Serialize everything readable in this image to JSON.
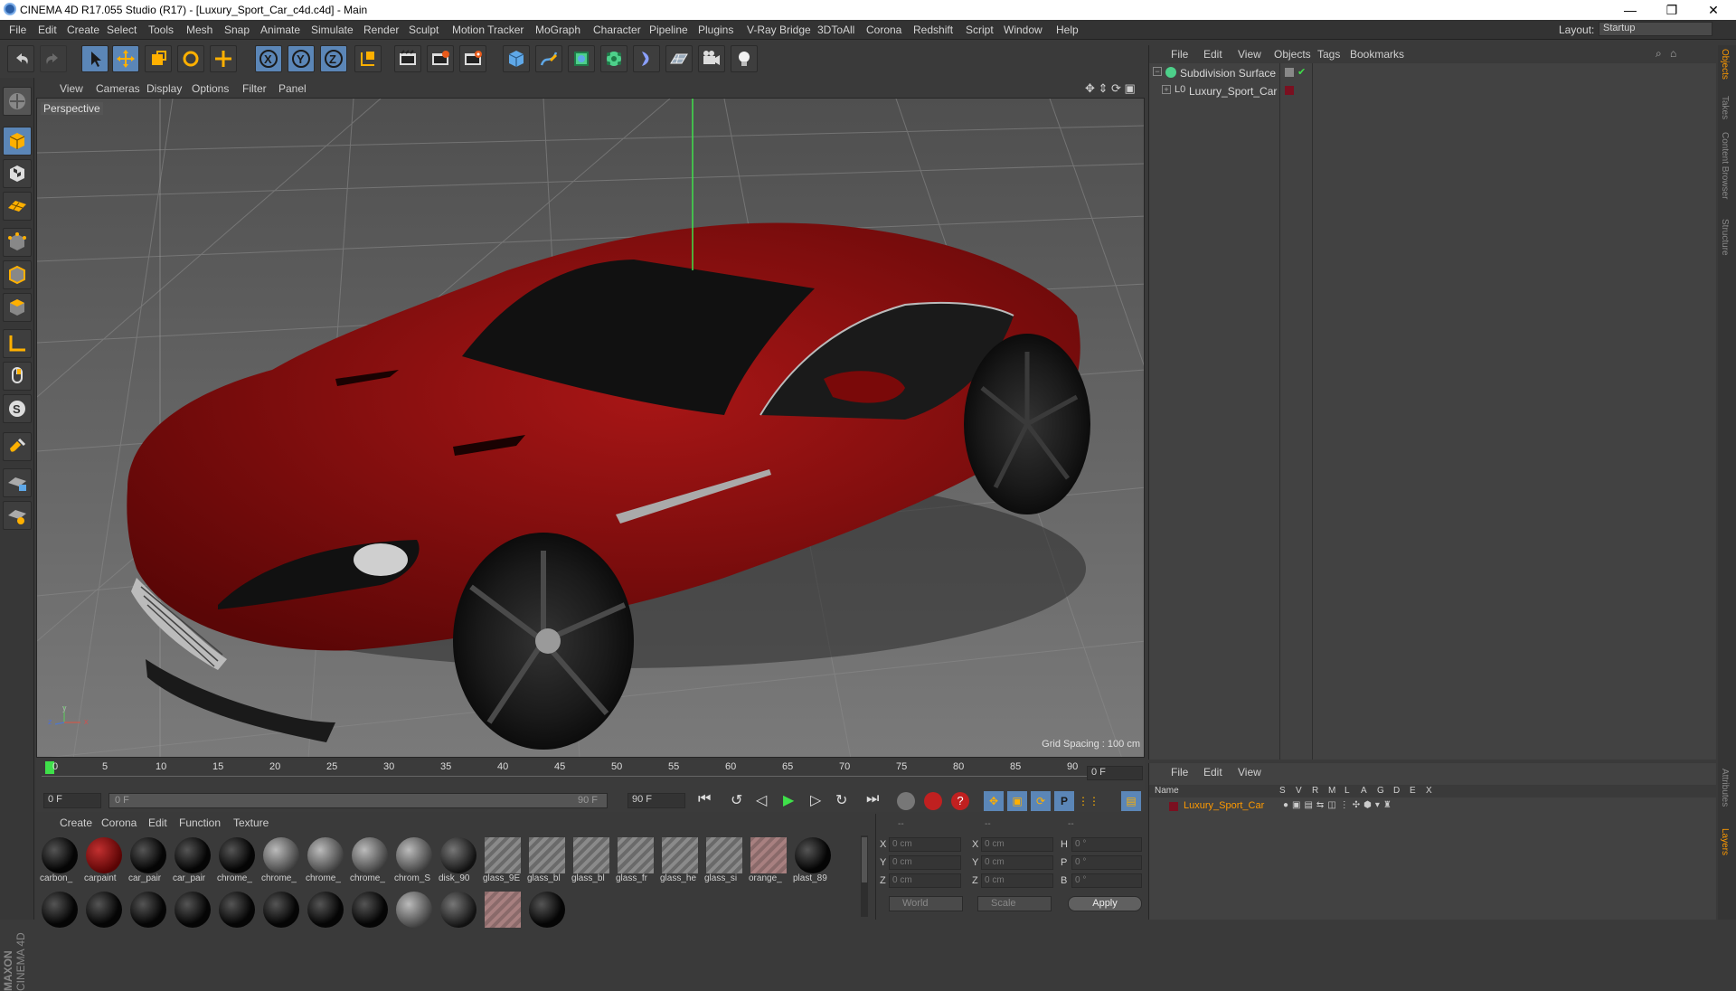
{
  "titlebar": {
    "title": "CINEMA 4D R17.055 Studio (R17) - [Luxury_Sport_Car_c4d.c4d] - Main",
    "minimize": "—",
    "restore": "❐",
    "close": "✕"
  },
  "menubar": {
    "items": [
      "File",
      "Edit",
      "Create",
      "Select",
      "Tools",
      "Mesh",
      "Snap",
      "Animate",
      "Simulate",
      "Render",
      "Sculpt",
      "Motion Tracker",
      "MoGraph",
      "Character",
      "Pipeline",
      "Plugins",
      "V-Ray Bridge",
      "3DToAll",
      "Corona",
      "Redshift",
      "Script",
      "Window",
      "Help"
    ],
    "layout_label": "Layout:",
    "layout_value": "Startup"
  },
  "viewport": {
    "menu": [
      "View",
      "Cameras",
      "Display",
      "Options",
      "Filter",
      "Panel"
    ],
    "camera_label": "Perspective",
    "grid_spacing": "Grid Spacing : 100 cm",
    "axis_x": "x",
    "axis_y": "y",
    "axis_z": "z"
  },
  "timeline": {
    "ticks": [
      "0",
      "5",
      "10",
      "15",
      "20",
      "25",
      "30",
      "35",
      "40",
      "45",
      "50",
      "55",
      "60",
      "65",
      "70",
      "75",
      "80",
      "85",
      "90"
    ],
    "current_frame": "0 F",
    "start_field": "0 F",
    "range_start": "0 F",
    "range_end": "90 F",
    "end_field": "90 F"
  },
  "materials": {
    "menu": [
      "Create",
      "Corona",
      "Edit",
      "Function",
      "Texture"
    ],
    "row1": [
      {
        "label": "carbon_",
        "kind": "black"
      },
      {
        "label": "carpaint",
        "kind": "red"
      },
      {
        "label": "car_pair",
        "kind": "black"
      },
      {
        "label": "car_pair",
        "kind": "black"
      },
      {
        "label": "chrome_",
        "kind": "black"
      },
      {
        "label": "chrome_",
        "kind": "grey"
      },
      {
        "label": "chrome_",
        "kind": "grey"
      },
      {
        "label": "chrome_",
        "kind": "grey"
      },
      {
        "label": "chrom_S",
        "kind": "grey"
      },
      {
        "label": "disk_90",
        "kind": "dark"
      },
      {
        "label": "glass_9E",
        "kind": "hatch"
      },
      {
        "label": "glass_bl",
        "kind": "hatch"
      },
      {
        "label": "glass_bl",
        "kind": "hatch"
      },
      {
        "label": "glass_fr",
        "kind": "hatch"
      },
      {
        "label": "glass_he",
        "kind": "hatch"
      },
      {
        "label": "glass_si",
        "kind": "hatch"
      },
      {
        "label": "orange_",
        "kind": "hatchred"
      },
      {
        "label": "plast_89",
        "kind": "black"
      }
    ],
    "row2_kinds": [
      "black",
      "black",
      "black",
      "black",
      "black",
      "black",
      "black",
      "black",
      "grey",
      "dark",
      "hatchred",
      "black"
    ]
  },
  "coords": {
    "header": [
      "--",
      "--",
      "--"
    ],
    "rows": [
      {
        "a": "X",
        "av": "0 cm",
        "b": "X",
        "bv": "0 cm",
        "c": "H",
        "cv": "0 °"
      },
      {
        "a": "Y",
        "av": "0 cm",
        "b": "Y",
        "bv": "0 cm",
        "c": "P",
        "cv": "0 °"
      },
      {
        "a": "Z",
        "av": "0 cm",
        "b": "Z",
        "bv": "0 cm",
        "c": "B",
        "cv": "0 °"
      }
    ],
    "world": "World",
    "scale": "Scale",
    "apply": "Apply"
  },
  "objects": {
    "menu": [
      "File",
      "Edit",
      "View",
      "Objects",
      "Tags",
      "Bookmarks"
    ],
    "items": [
      {
        "name": "Subdivision Surface",
        "color": "#d8d8d8"
      },
      {
        "name": "Luxury_Sport_Car",
        "color": "#d8d8d8"
      }
    ]
  },
  "attributes": {
    "menu": [
      "File",
      "Edit",
      "View"
    ],
    "columns": [
      "Name",
      "S",
      "V",
      "R",
      "M",
      "L",
      "A",
      "G",
      "D",
      "E",
      "X"
    ],
    "layer_name": "Luxury_Sport_Car"
  },
  "right_tabs": [
    "Objects",
    "Takes",
    "Content Browser",
    "Structure",
    "Attributes",
    "Layers"
  ],
  "branding": {
    "maxon": "MAXON",
    "c4d": "CINEMA 4D"
  },
  "colors": {
    "car_red": "#8a0c0c",
    "accent_orange": "#ff9a00"
  }
}
